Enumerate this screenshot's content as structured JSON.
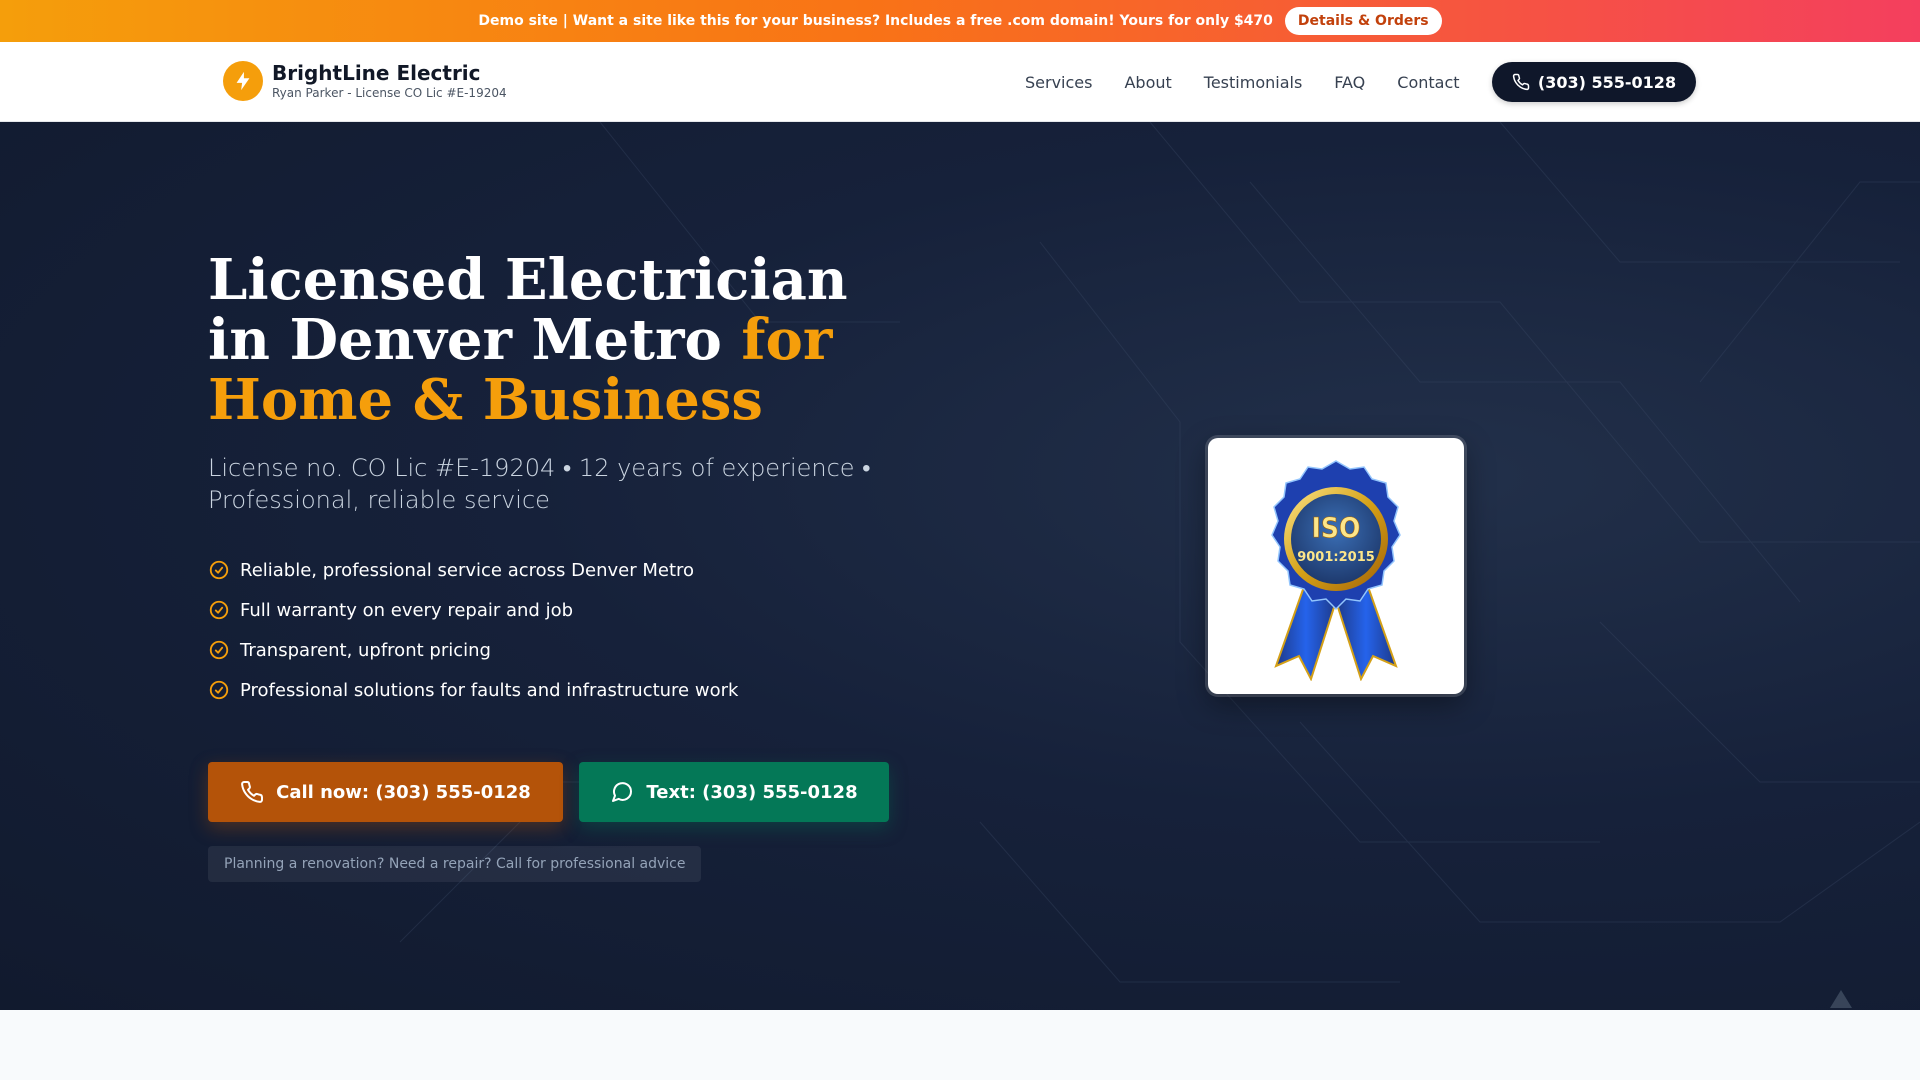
{
  "promo": {
    "text": "Demo site | Want a site like this for your business? Includes a free .com domain! Yours for only $470",
    "button": "Details & Orders"
  },
  "header": {
    "brand_name": "BrightLine Electric",
    "brand_sub": "Ryan Parker - License CO Lic #E-19204",
    "nav": [
      "Services",
      "About",
      "Testimonials",
      "FAQ",
      "Contact"
    ],
    "phone": "(303) 555-0128"
  },
  "hero": {
    "title_white": "Licensed Electrician in Denver Metro ",
    "title_accent": "for Home & Business",
    "subtitle": "License no. CO Lic #E-19204 • 12 years of experience • Professional, reliable service",
    "features": [
      "Reliable, professional service across Denver Metro",
      "Full warranty on every repair and job",
      "Transparent, upfront pricing",
      "Professional solutions for faults and infrastructure work"
    ],
    "call_button": "Call now: (303) 555-0128",
    "text_button": "Text: (303) 555-0128",
    "hint": "Planning a renovation? Need a repair? Call for professional advice",
    "badge": {
      "line1": "ISO",
      "line2": "9001:2015"
    }
  },
  "colors": {
    "accent": "#f59e0b",
    "dark": "#0f172a",
    "call": "#b45309",
    "text": "#047857"
  },
  "icons": [
    "bolt-icon",
    "phone-icon",
    "check-circle-icon",
    "chat-icon",
    "iso-badge",
    "scroll-top-icon"
  ]
}
